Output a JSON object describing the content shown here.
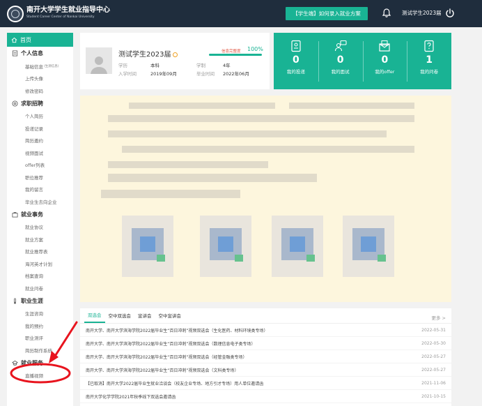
{
  "header": {
    "title": "南开大学学生就业指导中心",
    "subtitle": "Student Career Center of Nankai University",
    "action_button": "【学生端】如何录入就业方案",
    "user_name": "测试学生2023届",
    "icons": [
      "logo-icon",
      "bell-icon",
      "power-icon"
    ]
  },
  "sidebar": {
    "home": "首页",
    "groups": [
      {
        "label": "个人信息",
        "icon": "person-doc-icon",
        "items": [
          {
            "label": "基础信息",
            "note": "(生源信息)"
          },
          {
            "label": "上传头像"
          },
          {
            "label": "修改密码"
          }
        ]
      },
      {
        "label": "求职招聘",
        "icon": "target-icon",
        "items": [
          {
            "label": "个人简历"
          },
          {
            "label": "投递记录"
          },
          {
            "label": "简历邀约"
          },
          {
            "label": "视频面试"
          },
          {
            "label": "offer列表"
          },
          {
            "label": "职位推荐"
          },
          {
            "label": "我的留言"
          },
          {
            "label": "毕业生去向企业"
          }
        ]
      },
      {
        "label": "就业事务",
        "icon": "briefcase-icon",
        "items": [
          {
            "label": "就业协议"
          },
          {
            "label": "就业方案"
          },
          {
            "label": "就业推荐表"
          },
          {
            "label": "海河英才计划"
          },
          {
            "label": "档案查询"
          },
          {
            "label": "就业问卷"
          }
        ]
      },
      {
        "label": "职业生涯",
        "icon": "thermometer-icon",
        "items": [
          {
            "label": "生涯咨询"
          },
          {
            "label": "我的预约"
          },
          {
            "label": "职业测评"
          },
          {
            "label": "简历制作系统"
          }
        ]
      },
      {
        "label": "就业服务",
        "icon": "service-icon",
        "items": [
          {
            "label": "直播视频"
          }
        ]
      }
    ]
  },
  "profile": {
    "name": "测试学生2023届",
    "completion_label": "信息完整度",
    "completion_value": "100%",
    "completion": 1.0,
    "fields": [
      {
        "label": "学历",
        "value": "本科"
      },
      {
        "label": "学制",
        "value": "4年"
      },
      {
        "label": "入学时间",
        "value": "2019年09月"
      },
      {
        "label": "毕业时间",
        "value": "2022年06月"
      }
    ]
  },
  "stats": [
    {
      "value": "0",
      "label": "我的投递",
      "icon": "document-icon"
    },
    {
      "value": "0",
      "label": "我的面试",
      "icon": "people-chat-icon"
    },
    {
      "value": "0",
      "label": "我的offer",
      "icon": "envelope-icon"
    },
    {
      "value": "1",
      "label": "我的问卷",
      "icon": "questionnaire-icon"
    }
  ],
  "news": {
    "tabs": [
      "双选会",
      "空中双选会",
      "宣讲会",
      "空中宣讲会"
    ],
    "more": "更多 >",
    "rows": [
      {
        "title": "南开大学、南开大学滨海学院2022届毕业生“百日冲刺”视频双选会（生化医药、材料环境类专场）",
        "date": "2022-05-31"
      },
      {
        "title": "南开大学、南开大学滨海学院2022届毕业生“百日冲刺”视频双选会（数理信息电子类专场）",
        "date": "2022-05-30"
      },
      {
        "title": "南开大学、南开大学滨海学院2022届毕业生“百日冲刺”视频双选会（经管金融类专场）",
        "date": "2022-05-27"
      },
      {
        "title": "南开大学、南开大学滨海学院2022届毕业生“百日冲刺”视频双选会（文科类专场）",
        "date": "2022-05-27"
      },
      {
        "title": "【已取消】南开大学2022届毕业生就业洽谈会（校友企业专场、地方引才专场）用人单位邀请函",
        "date": "2021-11-06"
      },
      {
        "title": "南开大学化学学院2021年秋季线下双选会邀请函",
        "date": "2021-10-15"
      }
    ]
  },
  "colors": {
    "accent": "#19b394",
    "header_bg": "#1f2d3d",
    "annotation": "#e8141e"
  }
}
